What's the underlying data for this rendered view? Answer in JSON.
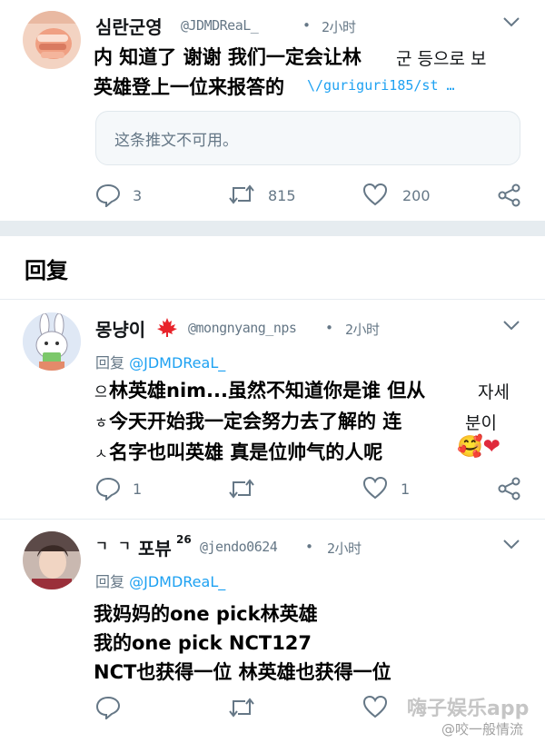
{
  "tweet1": {
    "display_name": "심란군영",
    "handle": "@JDMDReaL_",
    "dot": "•",
    "time": "2小时",
    "overlay_line1": "内 知道了 谢谢 我们一定会让林",
    "overlay_line2": "英雄登上一位来报答的",
    "ko_partial": "군 등으로 보",
    "link_partial": "\\/guriguri185/st …",
    "quoted_unavailable": "这条推文不可用。",
    "reply_count": "3",
    "retweet_count": "815",
    "like_count": "200"
  },
  "section": {
    "title": "回复"
  },
  "tweet2": {
    "display_name": "몽냥이",
    "flag_icon": "maple-leaf-icon",
    "handle": "@mongnyang_nps",
    "dot": "•",
    "time": "2小时",
    "reply_prefix": "回复",
    "reply_handle": "@JDMDReaL_",
    "overlay_line1": "林英雄nim...虽然不知道你是谁 但从",
    "overlay_line2": "今天开始我一定会努力去了解的 连",
    "overlay_line3": "名字也叫英雄 真是位帅气的人呢",
    "ko_left": [
      "으",
      "ㅎ",
      "ㅅ"
    ],
    "ko_right1": "자세",
    "ko_right2": "분이",
    "reply_count": "1",
    "like_count": "1",
    "emoji": "🥰❤"
  },
  "tweet3": {
    "display_name_prefix": "ㄱ ㄱ",
    "display_name": "포뷰",
    "display_name_sup": "26",
    "handle": "@jendo0624",
    "dot": "•",
    "time": "2小时",
    "reply_prefix": "回复",
    "reply_handle": "@JDMDReaL_",
    "overlay_line1": "我妈妈的one pick林英雄",
    "overlay_line2": "我的one pick NCT127",
    "overlay_line3": "NCT也获得一位 林英雄也获得一位"
  },
  "watermark": {
    "line1": "嗨子娱乐app",
    "line2": "@咬一般情流"
  },
  "colors": {
    "accent": "#1da1f2",
    "muted": "#657786",
    "divider": "#e6ecf0"
  }
}
